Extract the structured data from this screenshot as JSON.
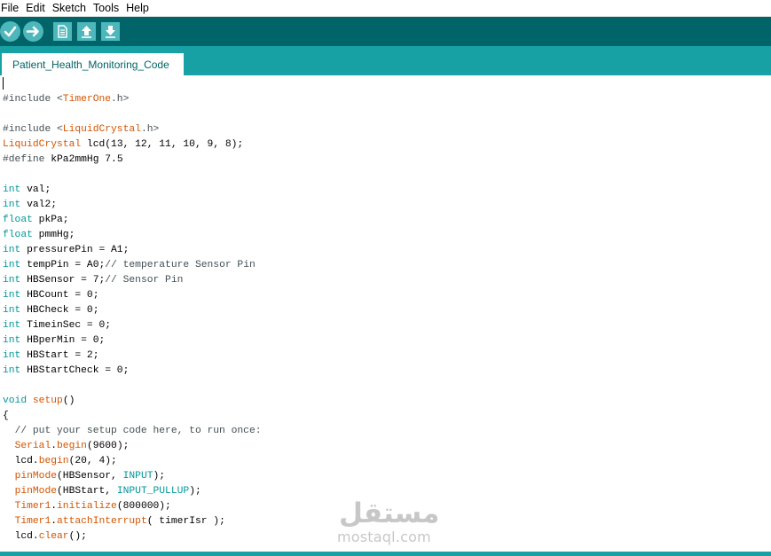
{
  "menu": {
    "items": [
      "File",
      "Edit",
      "Sketch",
      "Tools",
      "Help"
    ]
  },
  "toolbar": {
    "buttons": [
      "verify",
      "upload",
      "new",
      "open",
      "save"
    ]
  },
  "tab": {
    "title": "Patient_Health_Monitoring_Code"
  },
  "colors": {
    "toolbar_bg": "#006468",
    "tab_strip_bg": "#17a1a5",
    "button_bg": "#4db7bb",
    "keyword": "#00979c",
    "function": "#d35400",
    "comment": "#434f54"
  },
  "code": {
    "lines": [
      [],
      [
        [
          "pp",
          "#include <"
        ],
        [
          "fn",
          "TimerOne"
        ],
        [
          "pp",
          ".h>"
        ]
      ],
      [],
      [
        [
          "pp",
          "#include <"
        ],
        [
          "fn",
          "LiquidCrystal"
        ],
        [
          "pp",
          ".h>"
        ]
      ],
      [
        [
          "fn",
          "LiquidCrystal"
        ],
        [
          "tx",
          " lcd(13, 12, 11, 10, 9, 8);"
        ]
      ],
      [
        [
          "pp",
          "#define"
        ],
        [
          "tx",
          " kPa2mmHg 7.5"
        ]
      ],
      [],
      [
        [
          "kw",
          "int"
        ],
        [
          "tx",
          " val;"
        ]
      ],
      [
        [
          "kw",
          "int"
        ],
        [
          "tx",
          " val2;"
        ]
      ],
      [
        [
          "kw",
          "float"
        ],
        [
          "tx",
          " pkPa;"
        ]
      ],
      [
        [
          "kw",
          "float"
        ],
        [
          "tx",
          " pmmHg;"
        ]
      ],
      [
        [
          "kw",
          "int"
        ],
        [
          "tx",
          " pressurePin = A1;"
        ]
      ],
      [
        [
          "kw",
          "int"
        ],
        [
          "tx",
          " tempPin = A0;"
        ],
        [
          "cm",
          "// temperature Sensor Pin"
        ]
      ],
      [
        [
          "kw",
          "int"
        ],
        [
          "tx",
          " HBSensor = 7;"
        ],
        [
          "cm",
          "// Sensor Pin"
        ]
      ],
      [
        [
          "kw",
          "int"
        ],
        [
          "tx",
          " HBCount = 0;"
        ]
      ],
      [
        [
          "kw",
          "int"
        ],
        [
          "tx",
          " HBCheck = 0;"
        ]
      ],
      [
        [
          "kw",
          "int"
        ],
        [
          "tx",
          " TimeinSec = 0;"
        ]
      ],
      [
        [
          "kw",
          "int"
        ],
        [
          "tx",
          " HBperMin = 0;"
        ]
      ],
      [
        [
          "kw",
          "int"
        ],
        [
          "tx",
          " HBStart = 2;"
        ]
      ],
      [
        [
          "kw",
          "int"
        ],
        [
          "tx",
          " HBStartCheck = 0;"
        ]
      ],
      [],
      [
        [
          "kw",
          "void"
        ],
        [
          "tx",
          " "
        ],
        [
          "fn",
          "setup"
        ],
        [
          "tx",
          "()"
        ]
      ],
      [
        [
          "tx",
          "{"
        ]
      ],
      [
        [
          "tx",
          "  "
        ],
        [
          "cm",
          "// put your setup code here, to run once:"
        ]
      ],
      [
        [
          "tx",
          "  "
        ],
        [
          "fn",
          "Serial"
        ],
        [
          "tx",
          "."
        ],
        [
          "fn",
          "begin"
        ],
        [
          "tx",
          "(9600);"
        ]
      ],
      [
        [
          "tx",
          "  lcd."
        ],
        [
          "fn",
          "begin"
        ],
        [
          "tx",
          "(20, 4);"
        ]
      ],
      [
        [
          "tx",
          "  "
        ],
        [
          "fn",
          "pinMode"
        ],
        [
          "tx",
          "(HBSensor, "
        ],
        [
          "kw",
          "INPUT"
        ],
        [
          "tx",
          ");"
        ]
      ],
      [
        [
          "tx",
          "  "
        ],
        [
          "fn",
          "pinMode"
        ],
        [
          "tx",
          "(HBStart, "
        ],
        [
          "kw",
          "INPUT_PULLUP"
        ],
        [
          "tx",
          ");"
        ]
      ],
      [
        [
          "tx",
          "  "
        ],
        [
          "fn",
          "Timer1"
        ],
        [
          "tx",
          "."
        ],
        [
          "fn",
          "initialize"
        ],
        [
          "tx",
          "(800000);"
        ]
      ],
      [
        [
          "tx",
          "  "
        ],
        [
          "fn",
          "Timer1"
        ],
        [
          "tx",
          "."
        ],
        [
          "fn",
          "attachInterrupt"
        ],
        [
          "tx",
          "( timerIsr );"
        ]
      ],
      [
        [
          "tx",
          "  lcd."
        ],
        [
          "fn",
          "clear"
        ],
        [
          "tx",
          "();"
        ]
      ]
    ]
  },
  "watermark": {
    "arabic": "مستقل",
    "latin": "mostaql.com"
  }
}
